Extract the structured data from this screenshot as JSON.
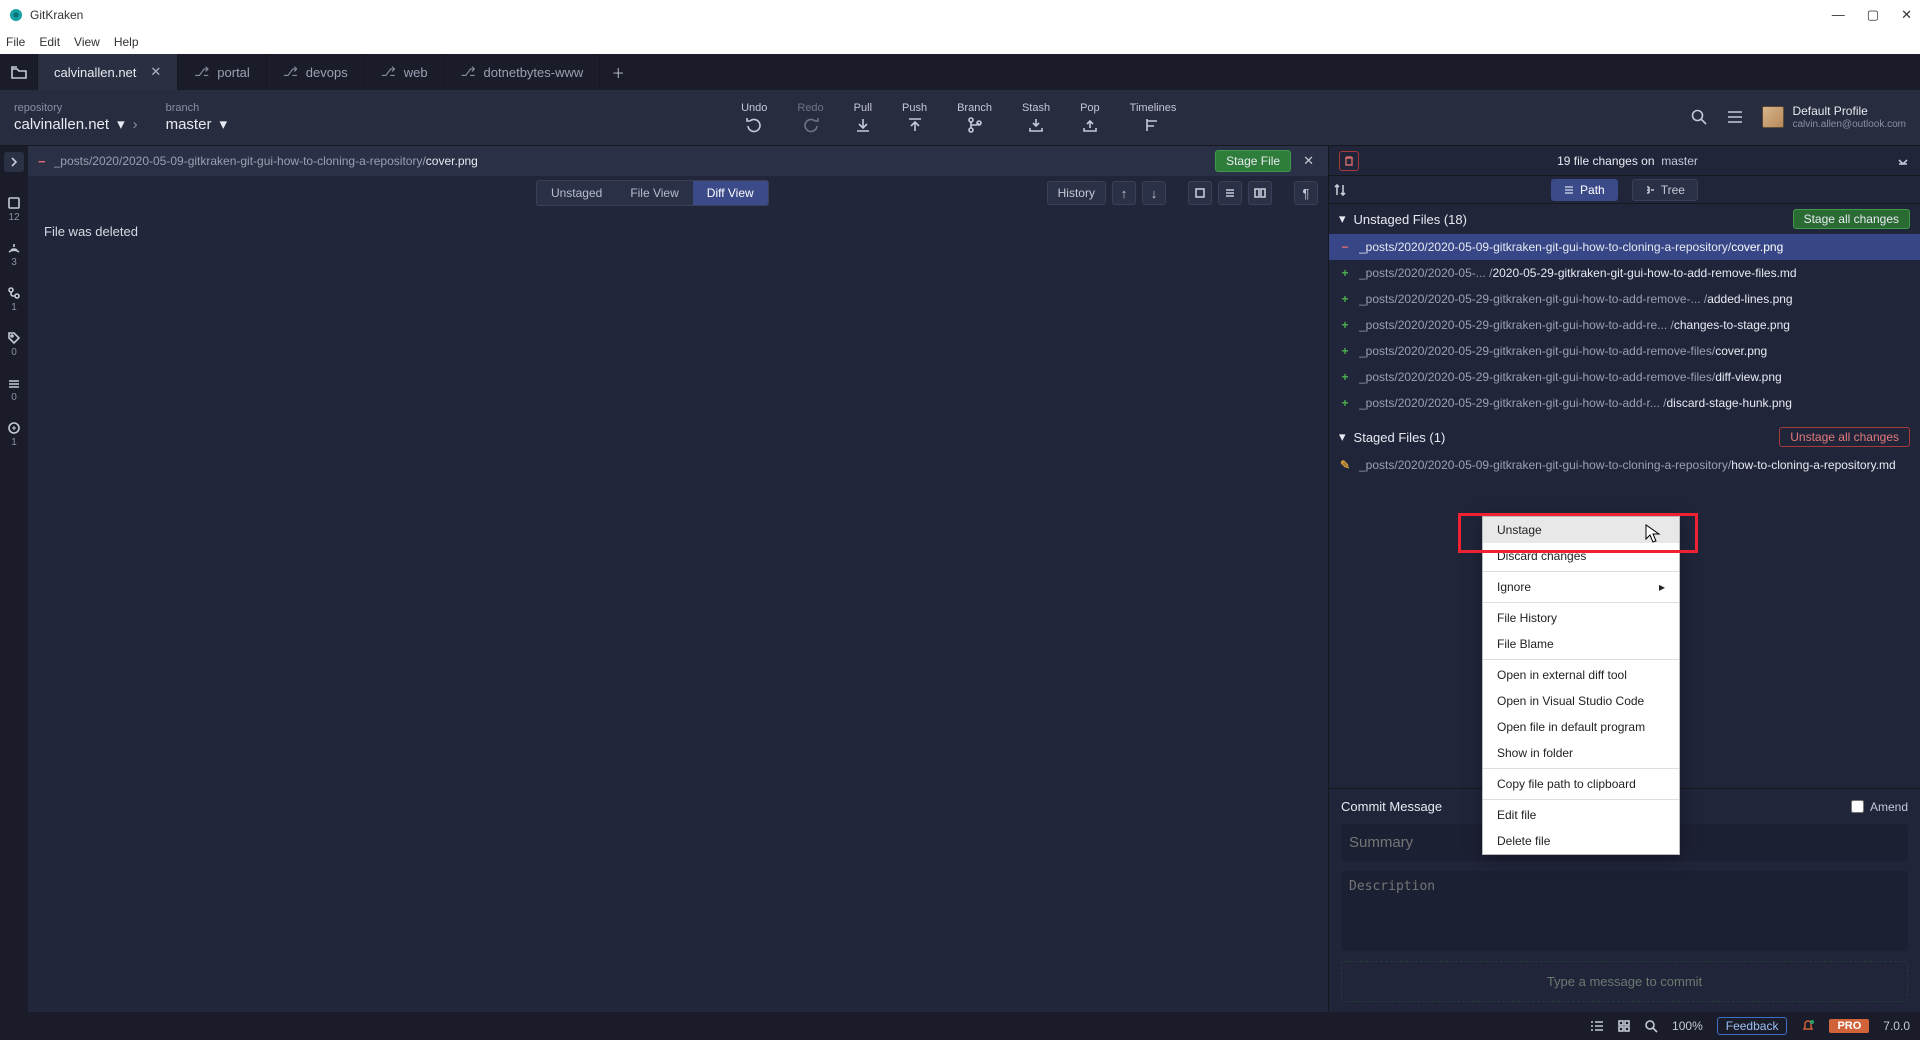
{
  "window": {
    "title": "GitKraken"
  },
  "menubar": [
    "File",
    "Edit",
    "View",
    "Help"
  ],
  "tabs": [
    {
      "label": "calvinallen.net",
      "active": true,
      "closable": true
    },
    {
      "label": "portal"
    },
    {
      "label": "devops"
    },
    {
      "label": "web"
    },
    {
      "label": "dotnetbytes-www"
    }
  ],
  "toolbar": {
    "repo_label": "repository",
    "repo": "calvinallen.net",
    "branch_label": "branch",
    "branch": "master",
    "buttons": [
      "Undo",
      "Redo",
      "Pull",
      "Push",
      "Branch",
      "Stash",
      "Pop",
      "Timelines"
    ],
    "profile_name": "Default Profile",
    "profile_email": "calvin.allen@outlook.com"
  },
  "leftgutter": [
    {
      "count": "12"
    },
    {
      "count": "3"
    },
    {
      "count": "1"
    },
    {
      "count": "0"
    },
    {
      "count": "0"
    },
    {
      "count": "1"
    }
  ],
  "filebar": {
    "status_glyph": "−",
    "path_pre": "_posts/2020/2020-05-09-gitkraken-git-gui-how-to-cloning-a-repository/",
    "path_file": "cover.png",
    "stage_button": "Stage File"
  },
  "viewtabs": {
    "seg": [
      "Unstaged",
      "File View",
      "Diff View"
    ],
    "active": 2,
    "history": "History"
  },
  "editor_text": "File was deleted",
  "changesbar": {
    "count": "19 file changes on",
    "branch": "master"
  },
  "pathmode": {
    "path": "Path",
    "tree": "Tree"
  },
  "unstaged": {
    "header": "Unstaged Files (18)",
    "button": "Stage all changes",
    "files": [
      {
        "mark": "del",
        "glyph": "−",
        "pre": "_posts/2020/2020-05-09-gitkraken-git-gui-how-to-cloning-a-repository/",
        "file": "cover.png",
        "selected": true
      },
      {
        "mark": "add",
        "glyph": "+",
        "pre": "_posts/2020/2020-05-... /",
        "file": "2020-05-29-gitkraken-git-gui-how-to-add-remove-files.md"
      },
      {
        "mark": "add",
        "glyph": "+",
        "pre": "_posts/2020/2020-05-29-gitkraken-git-gui-how-to-add-remove-... /",
        "file": "added-lines.png"
      },
      {
        "mark": "add",
        "glyph": "+",
        "pre": "_posts/2020/2020-05-29-gitkraken-git-gui-how-to-add-re... /",
        "file": "changes-to-stage.png"
      },
      {
        "mark": "add",
        "glyph": "+",
        "pre": "_posts/2020/2020-05-29-gitkraken-git-gui-how-to-add-remove-files/",
        "file": "cover.png"
      },
      {
        "mark": "add",
        "glyph": "+",
        "pre": "_posts/2020/2020-05-29-gitkraken-git-gui-how-to-add-remove-files/",
        "file": "diff-view.png"
      },
      {
        "mark": "add",
        "glyph": "+",
        "pre": "_posts/2020/2020-05-29-gitkraken-git-gui-how-to-add-r... /",
        "file": "discard-stage-hunk.png"
      }
    ]
  },
  "staged": {
    "header": "Staged Files (1)",
    "button": "Unstage all changes",
    "files": [
      {
        "mark": "mod",
        "glyph": "✎",
        "pre": "_posts/2020/2020-05-09-gitkraken-git-gui-how-to-cloning-a-repository/",
        "file": "how-to-cloning-a-repository.md"
      }
    ]
  },
  "commit": {
    "header": "Commit Message",
    "amend": "Amend",
    "summary": "Summary",
    "description": "Description",
    "button": "Type a message to commit"
  },
  "ctxmenu": {
    "items": [
      {
        "label": "Unstage",
        "hl": true
      },
      {
        "label": "Discard changes"
      },
      {
        "sep": true
      },
      {
        "label": "Ignore",
        "sub": true
      },
      {
        "sep": true
      },
      {
        "label": "File History"
      },
      {
        "label": "File Blame"
      },
      {
        "sep": true
      },
      {
        "label": "Open in external diff tool"
      },
      {
        "label": "Open in Visual Studio Code"
      },
      {
        "label": "Open file in default program"
      },
      {
        "label": "Show in folder"
      },
      {
        "sep": true
      },
      {
        "label": "Copy file path to clipboard"
      },
      {
        "sep": true
      },
      {
        "label": "Edit file"
      },
      {
        "label": "Delete file"
      }
    ]
  },
  "statusbar": {
    "zoom": "100%",
    "feedback": "Feedback",
    "pro": "PRO",
    "version": "7.0.0"
  }
}
